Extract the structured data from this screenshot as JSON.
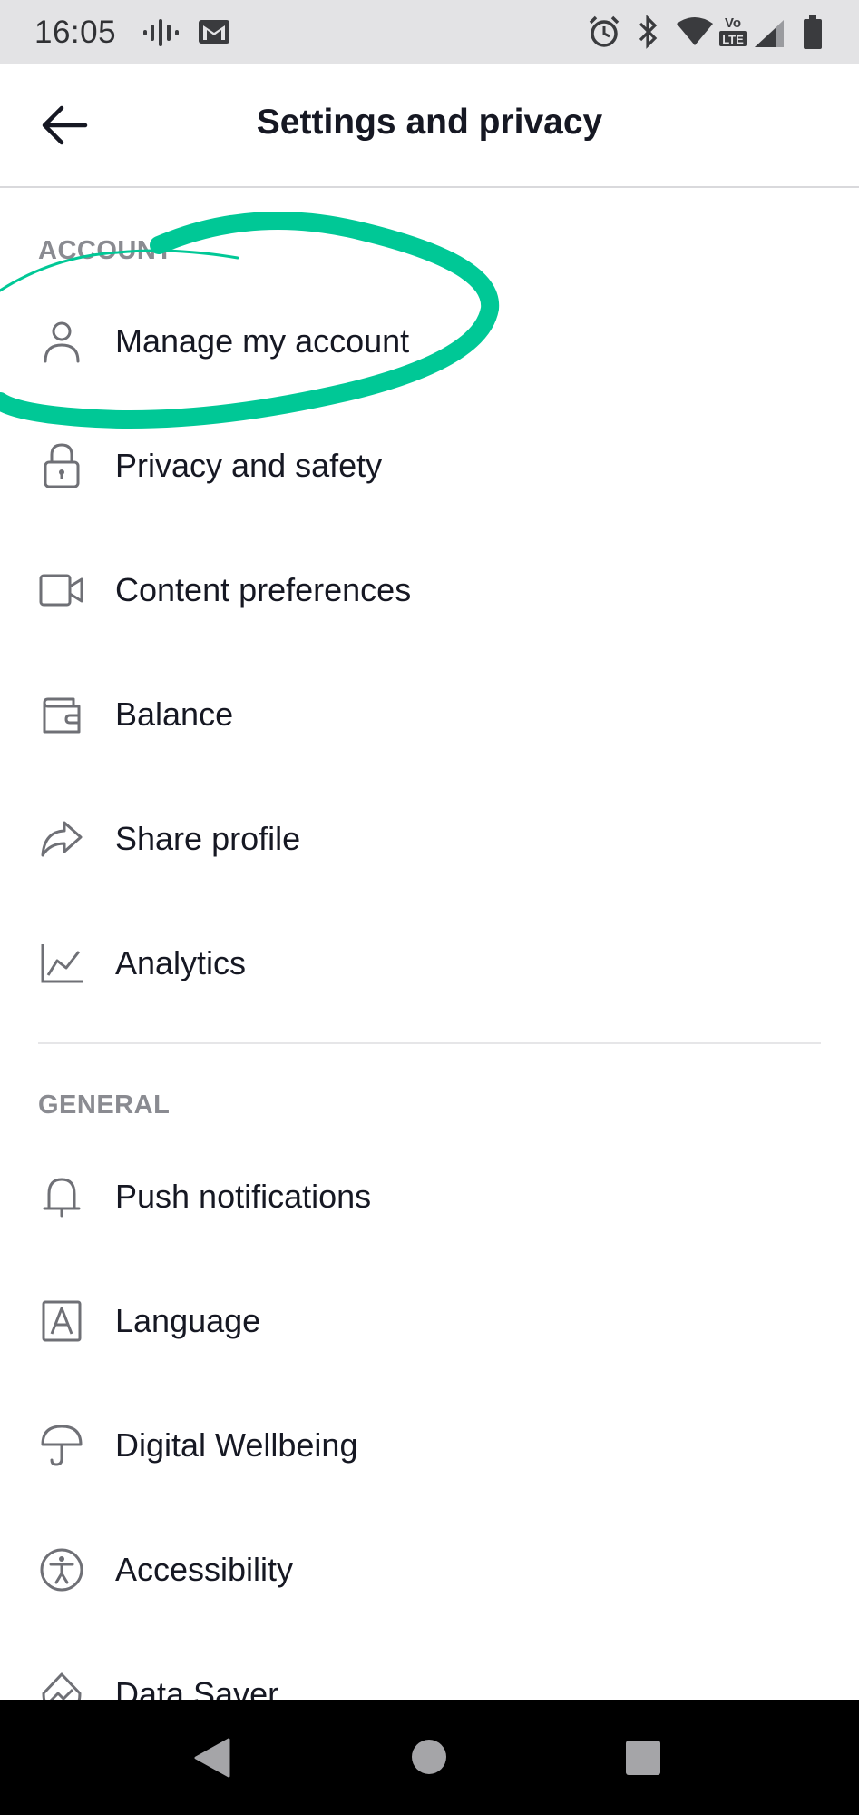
{
  "status_bar": {
    "time": "16:05",
    "icons": [
      "podcast-icon",
      "gmail-icon",
      "alarm-icon",
      "bluetooth-icon",
      "wifi-icon",
      "volte-icon",
      "signal-icon",
      "battery-icon"
    ]
  },
  "header": {
    "title": "Settings and privacy",
    "back_icon": "arrow-left-icon"
  },
  "sections": [
    {
      "title": "ACCOUNT",
      "items": [
        {
          "label": "Manage my account",
          "icon": "person-icon"
        },
        {
          "label": "Privacy and safety",
          "icon": "lock-icon"
        },
        {
          "label": "Content preferences",
          "icon": "video-camera-icon"
        },
        {
          "label": "Balance",
          "icon": "wallet-icon"
        },
        {
          "label": "Share profile",
          "icon": "share-arrow-icon"
        },
        {
          "label": "Analytics",
          "icon": "line-chart-icon"
        }
      ]
    },
    {
      "title": "GENERAL",
      "items": [
        {
          "label": "Push notifications",
          "icon": "bell-icon"
        },
        {
          "label": "Language",
          "icon": "language-a-icon"
        },
        {
          "label": "Digital Wellbeing",
          "icon": "umbrella-icon"
        },
        {
          "label": "Accessibility",
          "icon": "accessibility-icon"
        },
        {
          "label": "Data Saver",
          "icon": "data-saver-icon"
        }
      ]
    }
  ],
  "annotation": {
    "color": "#00c896",
    "shape": "circle-highlight"
  },
  "nav_bar": {
    "icons": [
      "back-triangle-icon",
      "home-circle-icon",
      "recents-square-icon"
    ]
  },
  "colors": {
    "status_bar_bg": "#e3e3e5",
    "section_header": "#8a8b91",
    "text": "#161823",
    "icon": "#6f7076"
  }
}
